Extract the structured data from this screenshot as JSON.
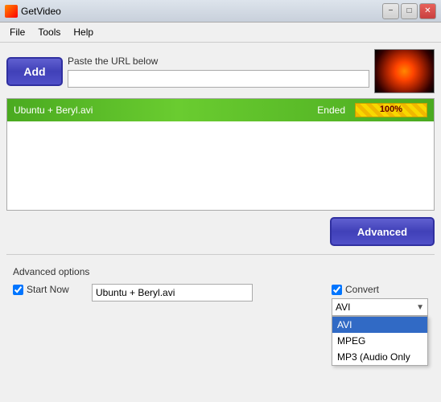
{
  "titlebar": {
    "title": "GetVideo",
    "icon": "getvideo-icon",
    "minimize_label": "−",
    "maximize_label": "□",
    "close_label": "✕"
  },
  "menubar": {
    "items": [
      {
        "label": "File"
      },
      {
        "label": "Tools"
      },
      {
        "label": "Help"
      }
    ]
  },
  "toolbar": {
    "add_label": "Add",
    "url_hint": "Paste the URL below"
  },
  "download_list": {
    "items": [
      {
        "name": "Ubuntu + Beryl.avi",
        "status": "Ended",
        "progress": "100%"
      }
    ]
  },
  "advanced_button": {
    "label": "Advanced"
  },
  "advanced_options": {
    "section_title": "Advanced options",
    "start_now_label": "Start Now",
    "start_now_checked": true,
    "filename_value": "Ubuntu + Beryl.avi",
    "convert_label": "Convert",
    "convert_checked": true,
    "format_selected": "AVI",
    "format_options": [
      {
        "label": "AVI",
        "selected": true
      },
      {
        "label": "MPEG",
        "selected": false
      },
      {
        "label": "MP3 (Audio Only",
        "selected": false
      }
    ]
  }
}
